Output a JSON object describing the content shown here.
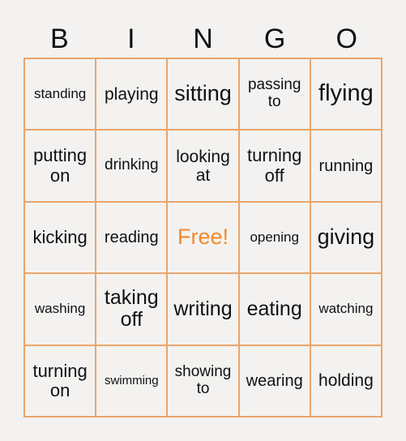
{
  "header": {
    "letters": [
      "B",
      "I",
      "N",
      "G",
      "O"
    ]
  },
  "board": {
    "free_color": "#f08a2a",
    "border_color": "#eaa56c",
    "rows": [
      [
        "standing",
        "playing",
        "sitting",
        "passing to",
        "flying"
      ],
      [
        "putting on",
        "drinking",
        "looking at",
        "turning off",
        "running"
      ],
      [
        "kicking",
        "reading",
        "Free!",
        "opening",
        "giving"
      ],
      [
        "washing",
        "taking off",
        "writing",
        "eating",
        "watching"
      ],
      [
        "turning on",
        "swimming",
        "showing to",
        "wearing",
        "holding"
      ]
    ]
  }
}
